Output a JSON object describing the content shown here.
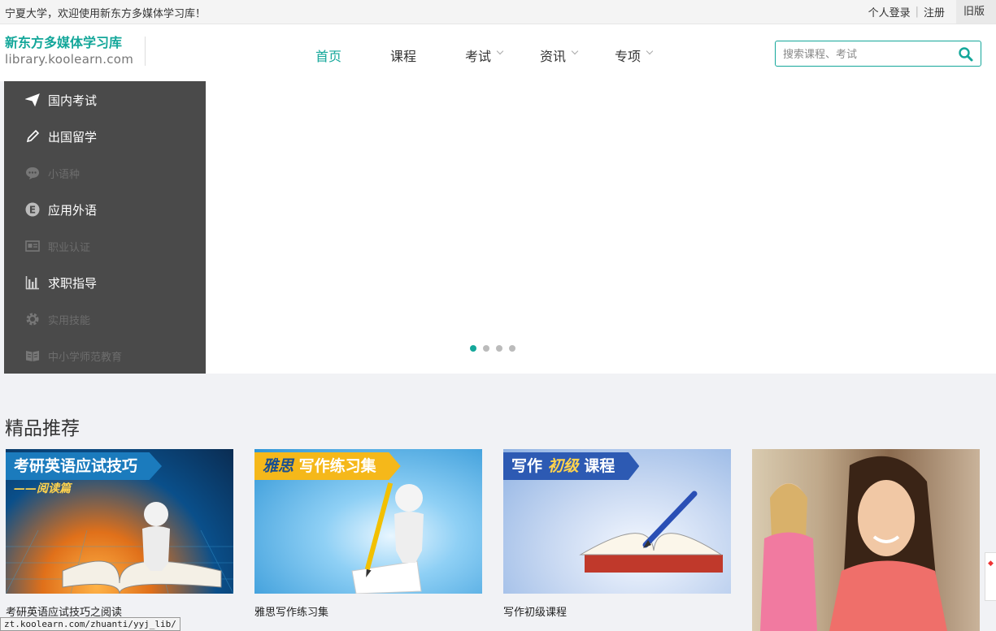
{
  "topbar": {
    "welcome": "宁夏大学，欢迎使用新东方多媒体学习库！",
    "login": "个人登录",
    "register": "注册",
    "old_version": "旧版"
  },
  "logo": {
    "title": "新东方多媒体学习库",
    "url": "library.koolearn.com"
  },
  "nav": {
    "home": "首页",
    "courses": "课程",
    "exams": "考试",
    "news": "资讯",
    "special": "专项"
  },
  "search": {
    "placeholder": "搜索课程、考试"
  },
  "sidebar": {
    "items": [
      {
        "label": "国内考试",
        "icon": "plane-icon"
      },
      {
        "label": "出国留学",
        "icon": "pencil-icon"
      },
      {
        "label": "小语种",
        "icon": "chat-icon"
      },
      {
        "label": "应用外语",
        "icon": "letter-e-icon"
      },
      {
        "label": "职业认证",
        "icon": "id-card-icon"
      },
      {
        "label": "求职指导",
        "icon": "bar-chart-icon"
      },
      {
        "label": "实用技能",
        "icon": "gear-icon"
      },
      {
        "label": "中小学师范教育",
        "icon": "book-icon"
      }
    ]
  },
  "section": {
    "title": "精品推荐",
    "cards": [
      {
        "caption": "考研英语应试技巧之阅读",
        "banner": "考研英语应试技巧",
        "sub": "——阅读篇"
      },
      {
        "caption": "雅思写作练习集",
        "banner_a": "雅思",
        "banner_b": "写作练习集"
      },
      {
        "caption": "写作初级课程",
        "banner_a": "写作",
        "banner_b": "初级",
        "banner_c": "课程"
      },
      {
        "caption": ""
      }
    ]
  },
  "statusbar": {
    "url": "zt.koolearn.com/zhuanti/yyj_lib/"
  },
  "colors": {
    "accent": "#14a79a",
    "sidebar_bg": "#4a4a4a"
  }
}
